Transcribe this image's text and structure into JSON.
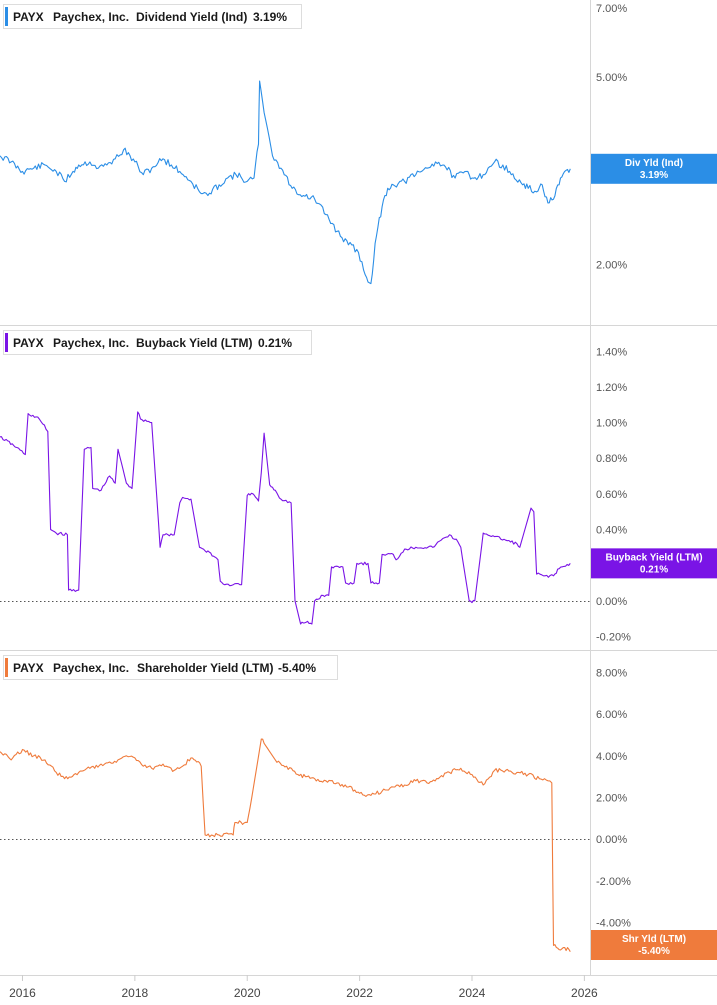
{
  "x_axis": {
    "ticks": [
      "2016",
      "2018",
      "2020",
      "2022",
      "2024",
      "2026"
    ],
    "range": [
      2015.6,
      2026.1
    ]
  },
  "chart_data": [
    {
      "type": "line",
      "ticker": "PAYX",
      "company": "Paychex, Inc.",
      "metric": "Dividend Yield (Ind)",
      "current": "3.19%",
      "badge": {
        "line1": "Div Yld (Ind)",
        "line2": "3.19%"
      },
      "color": "#2b8ee6",
      "scale": "log",
      "ylim": [
        1.68,
        7.0
      ],
      "y_ticks": [
        {
          "v": 7.0,
          "label": "7.00%"
        },
        {
          "v": 5.0,
          "label": "5.00%"
        },
        {
          "v": 2.0,
          "label": "2.00%"
        }
      ],
      "zero_line": false,
      "x": [
        2015.6,
        2015.8,
        2016.0,
        2016.2,
        2016.4,
        2016.6,
        2016.75,
        2016.9,
        2017.0,
        2017.2,
        2017.35,
        2017.5,
        2017.65,
        2017.8,
        2018.0,
        2018.15,
        2018.3,
        2018.5,
        2018.65,
        2018.8,
        2019.0,
        2019.15,
        2019.3,
        2019.5,
        2019.65,
        2019.8,
        2020.0,
        2020.12,
        2020.2,
        2020.22,
        2020.3,
        2020.45,
        2020.6,
        2020.8,
        2021.0,
        2021.2,
        2021.4,
        2021.6,
        2021.8,
        2021.95,
        2022.1,
        2022.2,
        2022.3,
        2022.4,
        2022.5,
        2022.6,
        2022.8,
        2023.0,
        2023.2,
        2023.35,
        2023.5,
        2023.7,
        2023.9,
        2024.0,
        2024.2,
        2024.4,
        2024.55,
        2024.7,
        2024.9,
        2025.0,
        2025.15,
        2025.25,
        2025.35,
        2025.45,
        2025.55,
        2025.65,
        2025.75
      ],
      "y": [
        3.4,
        3.3,
        3.15,
        3.2,
        3.25,
        3.15,
        3.0,
        3.15,
        3.25,
        3.3,
        3.2,
        3.25,
        3.35,
        3.5,
        3.3,
        3.1,
        3.2,
        3.35,
        3.25,
        3.15,
        3.0,
        2.85,
        2.8,
        2.95,
        3.05,
        3.1,
        3.0,
        3.05,
        3.6,
        4.9,
        4.2,
        3.4,
        3.2,
        2.9,
        2.8,
        2.75,
        2.55,
        2.35,
        2.2,
        2.15,
        1.9,
        1.82,
        2.3,
        2.65,
        2.9,
        2.95,
        3.0,
        3.1,
        3.2,
        3.3,
        3.25,
        3.05,
        3.15,
        3.05,
        3.1,
        3.3,
        3.25,
        3.1,
        2.95,
        2.9,
        2.85,
        2.95,
        2.7,
        2.75,
        2.95,
        3.15,
        3.19
      ]
    },
    {
      "type": "line",
      "ticker": "PAYX",
      "company": "Paychex, Inc.",
      "metric": "Buyback Yield (LTM)",
      "current": "0.21%",
      "badge": {
        "line1": "Buyback Yield (LTM)",
        "line2": "0.21%"
      },
      "color": "#7a14e6",
      "scale": "linear",
      "ylim": [
        -0.22,
        1.48
      ],
      "y_ticks": [
        {
          "v": 1.4,
          "label": "1.40%"
        },
        {
          "v": 1.2,
          "label": "1.20%"
        },
        {
          "v": 1.0,
          "label": "1.00%"
        },
        {
          "v": 0.8,
          "label": "0.80%"
        },
        {
          "v": 0.6,
          "label": "0.60%"
        },
        {
          "v": 0.4,
          "label": "0.40%"
        },
        {
          "v": 0.2,
          "label": "0.20%"
        },
        {
          "v": 0.0,
          "label": "0.00%"
        },
        {
          "v": -0.2,
          "label": "-0.20%"
        }
      ],
      "zero_line": true,
      "x": [
        2015.6,
        2015.9,
        2016.05,
        2016.1,
        2016.3,
        2016.45,
        2016.5,
        2016.6,
        2016.8,
        2016.82,
        2017.0,
        2017.1,
        2017.22,
        2017.25,
        2017.4,
        2017.55,
        2017.65,
        2017.7,
        2017.85,
        2017.95,
        2018.05,
        2018.1,
        2018.3,
        2018.45,
        2018.5,
        2018.7,
        2018.8,
        2018.85,
        2019.0,
        2019.15,
        2019.25,
        2019.3,
        2019.4,
        2019.48,
        2019.52,
        2019.6,
        2019.75,
        2019.9,
        2020.0,
        2020.1,
        2020.2,
        2020.25,
        2020.3,
        2020.4,
        2020.5,
        2020.6,
        2020.78,
        2020.85,
        2020.95,
        2021.05,
        2021.15,
        2021.2,
        2021.35,
        2021.45,
        2021.5,
        2021.7,
        2021.75,
        2021.9,
        2021.95,
        2022.15,
        2022.2,
        2022.35,
        2022.4,
        2022.6,
        2022.65,
        2022.8,
        2023.0,
        2023.3,
        2023.45,
        2023.6,
        2023.75,
        2023.8,
        2023.95,
        2024.0,
        2024.05,
        2024.2,
        2024.4,
        2024.6,
        2024.8,
        2024.85,
        2025.05,
        2025.1,
        2025.15,
        2025.3,
        2025.45,
        2025.55,
        2025.75
      ],
      "y": [
        0.92,
        0.86,
        0.82,
        1.05,
        1.02,
        0.95,
        0.4,
        0.38,
        0.37,
        0.06,
        0.06,
        0.85,
        0.86,
        0.63,
        0.62,
        0.7,
        0.66,
        0.85,
        0.66,
        0.63,
        1.06,
        1.02,
        1.0,
        0.3,
        0.37,
        0.37,
        0.55,
        0.58,
        0.57,
        0.3,
        0.28,
        0.28,
        0.25,
        0.23,
        0.11,
        0.09,
        0.09,
        0.09,
        0.59,
        0.6,
        0.56,
        0.72,
        0.94,
        0.65,
        0.62,
        0.57,
        0.55,
        0.0,
        -0.13,
        -0.12,
        -0.13,
        0.0,
        0.03,
        0.03,
        0.19,
        0.19,
        0.1,
        0.1,
        0.21,
        0.21,
        0.1,
        0.1,
        0.26,
        0.26,
        0.23,
        0.29,
        0.3,
        0.3,
        0.34,
        0.37,
        0.33,
        0.3,
        0.0,
        -0.01,
        0.0,
        0.38,
        0.36,
        0.34,
        0.32,
        0.3,
        0.52,
        0.5,
        0.15,
        0.14,
        0.14,
        0.18,
        0.21
      ]
    },
    {
      "type": "line",
      "ticker": "PAYX",
      "company": "Paychex, Inc.",
      "metric": "Shareholder Yield (LTM)",
      "current": "-5.40%",
      "badge": {
        "line1": "Shr Yld (LTM)",
        "line2": "-5.40%"
      },
      "color": "#ef7b3c",
      "scale": "linear",
      "ylim": [
        -5.8,
        8.5
      ],
      "y_ticks": [
        {
          "v": 8.0,
          "label": "8.00%"
        },
        {
          "v": 6.0,
          "label": "6.00%"
        },
        {
          "v": 4.0,
          "label": "4.00%"
        },
        {
          "v": 2.0,
          "label": "2.00%"
        },
        {
          "v": 0.0,
          "label": "0.00%"
        },
        {
          "v": -2.0,
          "label": "-2.00%"
        },
        {
          "v": -4.0,
          "label": "-4.00%"
        }
      ],
      "zero_line": true,
      "x": [
        2015.6,
        2015.8,
        2016.0,
        2016.2,
        2016.4,
        2016.6,
        2016.75,
        2017.0,
        2017.2,
        2017.4,
        2017.55,
        2017.7,
        2017.85,
        2018.0,
        2018.15,
        2018.3,
        2018.5,
        2018.7,
        2018.85,
        2019.0,
        2019.1,
        2019.18,
        2019.25,
        2019.5,
        2019.75,
        2019.78,
        2020.0,
        2020.05,
        2020.25,
        2020.3,
        2020.5,
        2020.7,
        2020.9,
        2021.2,
        2021.4,
        2021.6,
        2021.8,
        2022.0,
        2022.2,
        2022.4,
        2022.6,
        2022.8,
        2023.0,
        2023.2,
        2023.4,
        2023.6,
        2023.8,
        2024.0,
        2024.2,
        2024.4,
        2024.6,
        2024.8,
        2025.0,
        2025.2,
        2025.35,
        2025.42,
        2025.45,
        2025.55,
        2025.65,
        2025.75
      ],
      "y": [
        4.2,
        3.8,
        4.3,
        4.0,
        3.8,
        3.2,
        2.9,
        3.2,
        3.4,
        3.6,
        3.7,
        3.8,
        4.0,
        3.9,
        3.5,
        3.4,
        3.6,
        3.3,
        3.5,
        3.9,
        3.7,
        3.5,
        0.2,
        0.2,
        0.2,
        0.8,
        0.8,
        1.5,
        4.8,
        4.6,
        3.8,
        3.5,
        3.1,
        2.9,
        2.8,
        2.7,
        2.5,
        2.2,
        2.1,
        2.3,
        2.5,
        2.6,
        2.8,
        2.7,
        2.9,
        3.2,
        3.4,
        3.1,
        2.6,
        3.3,
        3.3,
        3.2,
        3.1,
        2.9,
        2.8,
        2.7,
        -5.1,
        -5.3,
        -5.2,
        -5.4
      ]
    }
  ]
}
